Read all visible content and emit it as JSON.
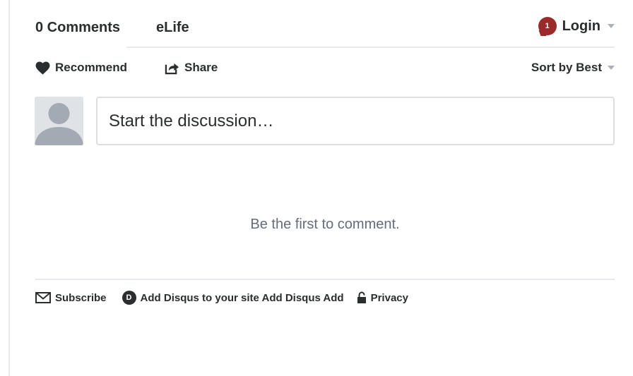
{
  "nav": {
    "comment_count": "0 Comments",
    "forum_name": "eLife",
    "login_label": "Login",
    "notification_count": "1"
  },
  "actions": {
    "recommend_label": "Recommend",
    "share_label": "Share",
    "sort_label": "Sort by Best"
  },
  "composer": {
    "placeholder": "Start the discussion…"
  },
  "empty_state": {
    "message": "Be the first to comment."
  },
  "footer": {
    "subscribe_label": "Subscribe",
    "disqus_logo_letter": "D",
    "add_disqus_label": "Add Disqus to your site Add Disqus Add",
    "privacy_label": "Privacy"
  },
  "icons": {
    "recommend": "heart-icon",
    "share": "share-icon",
    "subscribe": "envelope-icon",
    "disqus": "disqus-logo-icon",
    "privacy": "lock-icon",
    "dropdown": "chevron-down-icon"
  },
  "colors": {
    "badge": "#9b2a2a",
    "text": "#2a2e2e",
    "muted": "#656c7a",
    "divider": "#e7e9ee"
  }
}
